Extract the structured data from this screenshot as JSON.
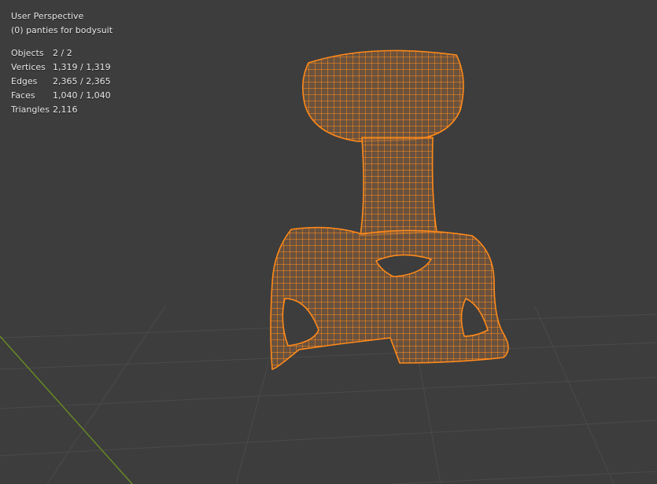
{
  "viewport": {
    "view_name": "User Perspective",
    "object_label": "(0) panties for bodysuit"
  },
  "stats": [
    {
      "label": "Objects",
      "value": "2 / 2"
    },
    {
      "label": "Vertices",
      "value": "1,319 / 1,319"
    },
    {
      "label": "Edges",
      "value": "2,365 / 2,365"
    },
    {
      "label": "Faces",
      "value": "1,040 / 1,040"
    },
    {
      "label": "Triangles",
      "value": "2,116"
    }
  ],
  "colors": {
    "background": "#3d3d3d",
    "grid": "#4a4a4a",
    "x_axis": "#6b8e23",
    "wire": "#ff8a1a",
    "fill": "#7a5a3e"
  }
}
